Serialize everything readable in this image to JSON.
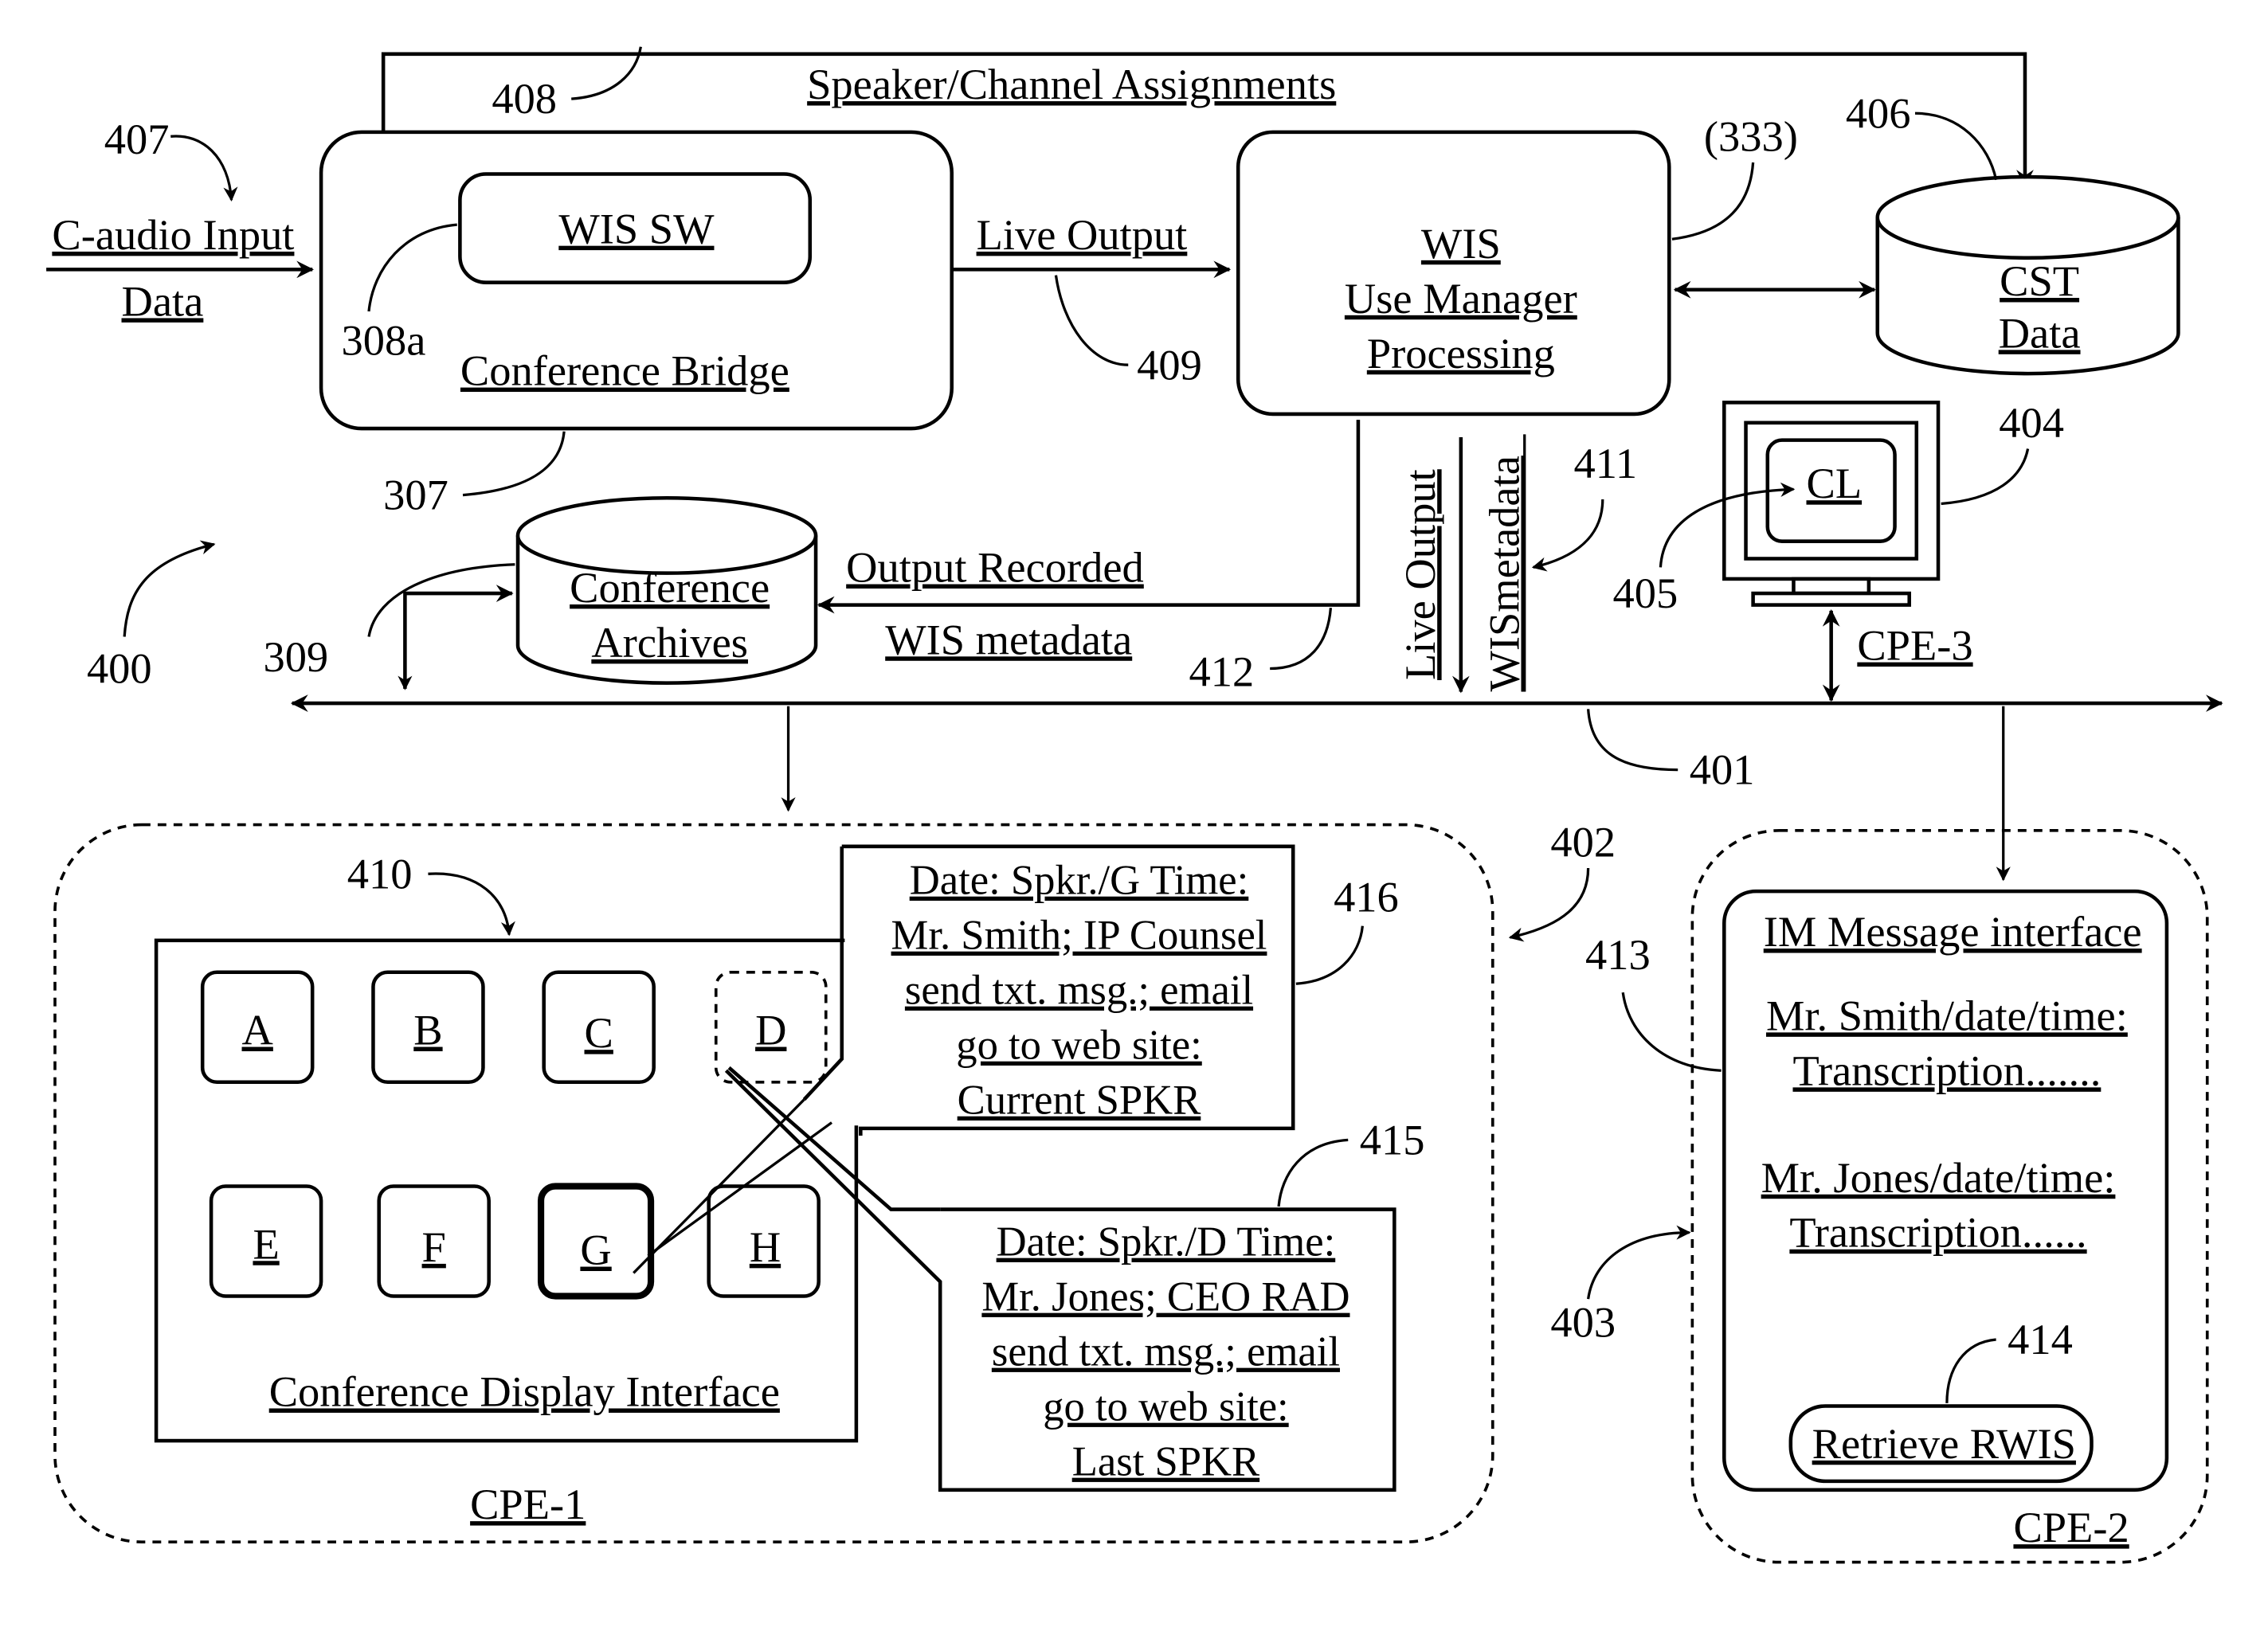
{
  "figure": {
    "ref_main": "400",
    "input": {
      "label_line1": "C-audio Input",
      "label_line2": "Data",
      "ref": "407"
    },
    "speaker_channel": {
      "label": "Speaker/Channel Assignments",
      "ref": "408"
    },
    "conference_bridge": {
      "label": "Conference Bridge",
      "ref": "307",
      "software": {
        "label": "WIS SW",
        "ref": "308a"
      }
    },
    "live_output": {
      "label": "Live Output",
      "ref": "409"
    },
    "use_manager": {
      "line1": "WIS",
      "line2": "Use Manager",
      "line3": "Processing",
      "ref": "(333)"
    },
    "cst_data": {
      "line1": "CST",
      "line2": "Data",
      "ref": "406"
    },
    "archives": {
      "line1": "Conference",
      "line2": "Archives",
      "ref": "309"
    },
    "output_recorded": {
      "line1": "Output Recorded",
      "line2": "WIS metadata",
      "ref": "412"
    },
    "vertical_labels": {
      "live_output": "Live Output",
      "wis_metadata": "WISmetadata",
      "ref": "411"
    },
    "cpe3": {
      "label": "CPE-3",
      "screen_label": "CL",
      "ref_monitor": "404",
      "ref_screen": "405"
    },
    "network": {
      "ref": "401"
    },
    "cpe1": {
      "label": "CPE-1",
      "ref_group": "402",
      "display": {
        "label": "Conference Display Interface",
        "ref": "410"
      },
      "tiles": [
        "A",
        "B",
        "C",
        "D",
        "E",
        "F",
        "G",
        "H"
      ],
      "callout_current": {
        "ref": "416",
        "lines": [
          "Date: Spkr./G Time:",
          "Mr. Smith; IP Counsel",
          "send txt. msg.; email",
          "go to web site:",
          "Current SPKR"
        ]
      },
      "callout_last": {
        "ref": "415",
        "lines": [
          "Date: Spkr./D Time:",
          "Mr. Jones; CEO RAD",
          "send txt. msg.; email",
          "go to web site:",
          "Last SPKR"
        ]
      }
    },
    "cpe2": {
      "label": "CPE-2",
      "ref_group": "403",
      "im": {
        "title": "IM Message interface",
        "ref": "413",
        "messages": [
          {
            "header": "Mr. Smith/date/time:",
            "body": "Transcription......."
          },
          {
            "header": "Mr. Jones/date/time:",
            "body": "Transcription......"
          }
        ],
        "button": {
          "label": "Retrieve RWIS",
          "ref": "414"
        }
      }
    }
  }
}
